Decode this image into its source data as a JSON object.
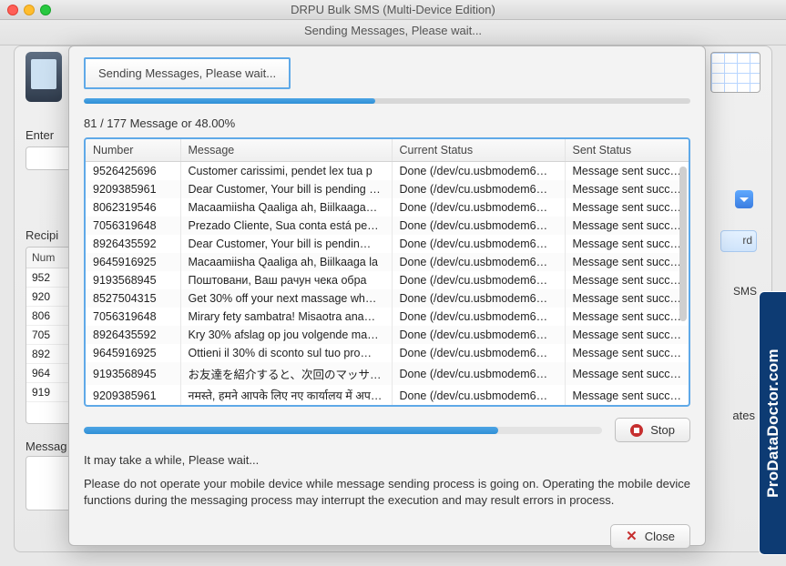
{
  "window": {
    "title": "DRPU Bulk SMS (Multi-Device Edition)",
    "subtitle": "Sending Messages, Please wait..."
  },
  "background": {
    "enter_label": "Enter",
    "recipient_label": "Recipi",
    "message_label": "Messag",
    "ates_partial": "ates",
    "sms_label": "SMS",
    "rd_label": "rd",
    "recip_header": "Num",
    "recip_rows": [
      "952",
      "920",
      "806",
      "705",
      "892",
      "964",
      "919"
    ]
  },
  "modal": {
    "header": "Sending Messages, Please wait...",
    "progress_pct_top": 48,
    "counter": "81 / 177 Message or  48.00%",
    "columns": [
      "Number",
      "Message",
      "Current Status",
      "Sent Status"
    ],
    "col_widths": [
      "104px",
      "232px",
      "190px",
      "140px"
    ],
    "rows": [
      {
        "number": "9526425696",
        "message": "Customer carissimi, pendet lex tua p",
        "status": "Done (/dev/cu.usbmodem6…",
        "sent": "Message sent succ…"
      },
      {
        "number": "9209385961",
        "message": "Dear Customer, Your bill is pending …",
        "status": "Done (/dev/cu.usbmodem6…",
        "sent": "Message sent succ…"
      },
      {
        "number": "8062319546",
        "message": "Macaamiisha Qaaliga ah, Biilkaaga…",
        "status": "Done (/dev/cu.usbmodem6…",
        "sent": "Message sent succ…"
      },
      {
        "number": "7056319648",
        "message": "Prezado Cliente, Sua conta está pe…",
        "status": "Done (/dev/cu.usbmodem6…",
        "sent": "Message sent succ…"
      },
      {
        "number": "8926435592",
        "message": "Dear Customer, Your bill is pendin…",
        "status": "Done (/dev/cu.usbmodem6…",
        "sent": "Message sent succ…"
      },
      {
        "number": "9645916925",
        "message": "Macaamiisha Qaaliga ah, Biilkaaga la",
        "status": "Done (/dev/cu.usbmodem6…",
        "sent": "Message sent succ…"
      },
      {
        "number": "9193568945",
        "message": "Поштовани, Ваш рачун чека обра",
        "status": "Done (/dev/cu.usbmodem6…",
        "sent": "Message sent succ…"
      },
      {
        "number": "8527504315",
        "message": "Get 30% off your next massage wh…",
        "status": "Done (/dev/cu.usbmodem6…",
        "sent": "Message sent succ…"
      },
      {
        "number": "7056319648",
        "message": "Mirary fety sambatra! Misaotra ana…",
        "status": "Done (/dev/cu.usbmodem6…",
        "sent": "Message sent succ…"
      },
      {
        "number": "8926435592",
        "message": "Kry 30% afslag op jou volgende ma…",
        "status": "Done (/dev/cu.usbmodem6…",
        "sent": "Message sent succ…"
      },
      {
        "number": "9645916925",
        "message": "Ottieni il 30% di sconto sul tuo pro…",
        "status": "Done (/dev/cu.usbmodem6…",
        "sent": "Message sent succ…"
      },
      {
        "number": "9193568945",
        "message": "お友達を紹介すると、次回のマッサ…",
        "status": "Done (/dev/cu.usbmodem6…",
        "sent": "Message sent succ…"
      },
      {
        "number": "9209385961",
        "message": "नमस्ते, हमने आपके लिए नए कार्यालय में अपने नए",
        "status": "Done (/dev/cu.usbmodem6…",
        "sent": "Message sent succ…"
      }
    ],
    "progress_pct_bottom": 80,
    "progress_color": "#4da4e4",
    "stop_label": "Stop",
    "wait_text": "It may take a while, Please wait...",
    "warning_text": "Please do not operate your mobile device while message sending process is going on. Operating the mobile device functions during the messaging process may interrupt the execution and may result errors in process.",
    "close_label": "Close"
  },
  "side_tab": "ProDataDoctor.com"
}
